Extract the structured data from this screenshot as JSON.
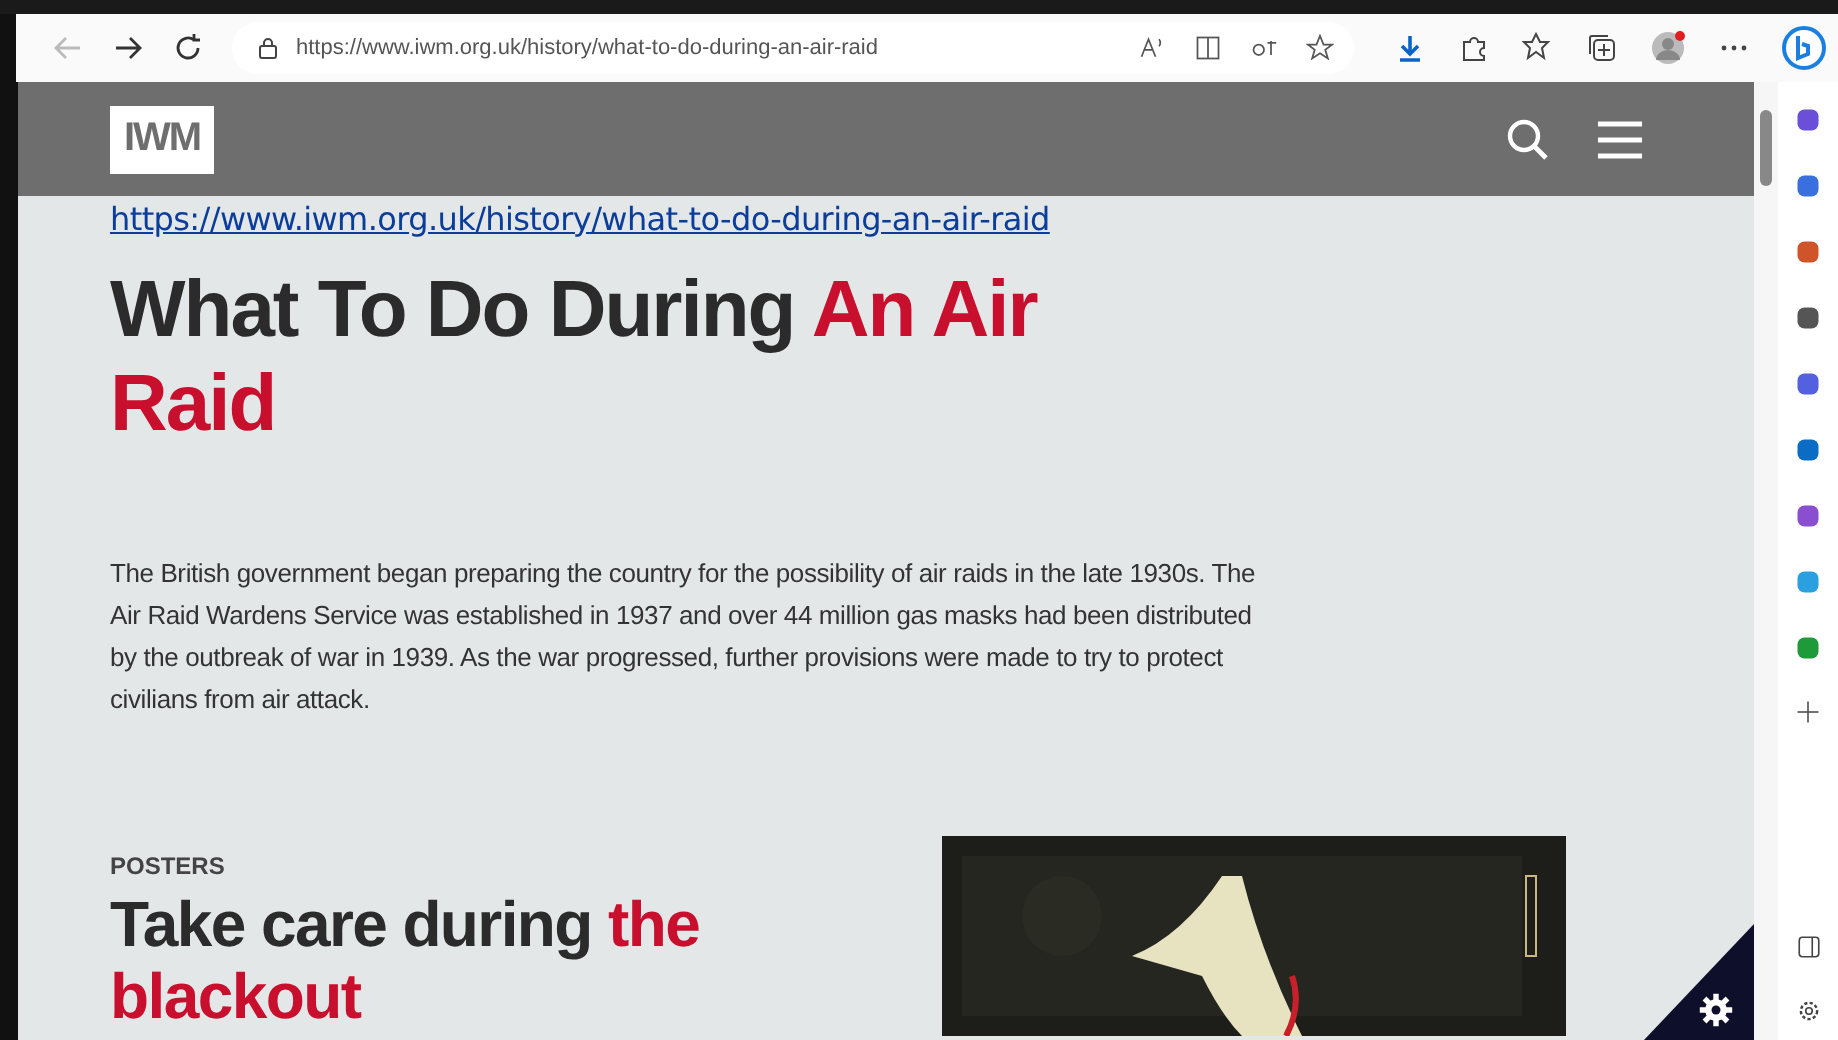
{
  "browser": {
    "url_host": "https://www.iwm.org.uk",
    "url_path": "/history/what-to-do-during-an-air-raid",
    "profile_notification": true
  },
  "site_header": {
    "logo": "IWM"
  },
  "page": {
    "link": "https://www.iwm.org.uk/history/what-to-do-during-an-air-raid",
    "title": {
      "plain": "What To Do During",
      "highlight": "An Air Raid"
    },
    "intro": "The British government began preparing the country for the possibility of air raids in the late 1930s. The Air Raid Wardens Service was established in 1937 and over 44 million gas masks had been distributed by the outbreak of war in 1939. As the war progressed, further provisions were made to try to protect civilians from air attack.",
    "section": {
      "eyebrow": "POSTERS",
      "title": {
        "plain": "Take care during",
        "highlight": "the blackout"
      }
    }
  }
}
